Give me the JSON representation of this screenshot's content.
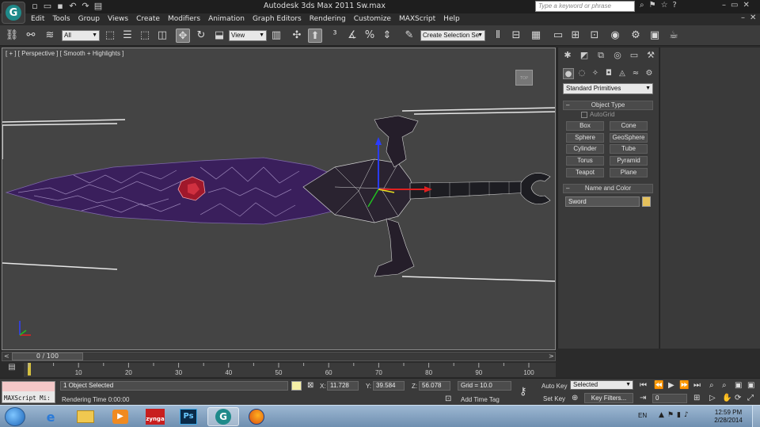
{
  "titlebar": {
    "app_title": "Autodesk 3ds Max  2011      Sw.max",
    "search_placeholder": "Type a keyword or phrase",
    "qat_icons": [
      "new-file-icon",
      "open-file-icon",
      "save-file-icon",
      "undo-icon",
      "redo-icon",
      "project-folder-icon"
    ]
  },
  "menu": {
    "items": [
      "Edit",
      "Tools",
      "Group",
      "Views",
      "Create",
      "Modifiers",
      "Animation",
      "Graph Editors",
      "Rendering",
      "Customize",
      "MAXScript",
      "Help"
    ]
  },
  "toolbar": {
    "filter_select": "All",
    "ref_coord_select": "View",
    "selection_set": "Create Selection Se"
  },
  "viewport": {
    "label": "[ + ] [ Perspective ] [ Smooth + Highlights ]",
    "viewcube_label": "TOP"
  },
  "command_panel": {
    "category_dropdown": "Standard Primitives",
    "object_type_header": "Object Type",
    "autogrid_label": "AutoGrid",
    "primitives": [
      "Box",
      "Cone",
      "Sphere",
      "GeoSphere",
      "Cylinder",
      "Tube",
      "Torus",
      "Pyramid",
      "Teapot",
      "Plane"
    ],
    "name_color_header": "Name and Color",
    "object_name": "Sword",
    "object_color": "#e5c15b"
  },
  "timeline": {
    "frame_counter": "0 / 100",
    "ticks": [
      "10",
      "20",
      "30",
      "40",
      "50",
      "60",
      "70",
      "80",
      "90",
      "100"
    ]
  },
  "status": {
    "maxscript_label": "MAXScript Mi:",
    "selection_status": "1 Object Selected",
    "rendering_time": "Rendering Time  0:00:00",
    "x_label": "X:",
    "x_value": "11.728",
    "y_label": "Y:",
    "y_value": "39.584",
    "z_label": "Z:",
    "z_value": "56.078",
    "grid": "Grid = 10.0",
    "add_time_tag": "Add Time Tag",
    "auto_key": "Auto Key",
    "set_key": "Set Key",
    "key_mode_select": "Selected",
    "key_filters": "Key Filters...",
    "current_frame": "0"
  },
  "taskbar": {
    "apps": [
      "internet-explorer",
      "windows-explorer",
      "media-player",
      "zynga",
      "photoshop",
      "3dsmax",
      "firefox"
    ],
    "zynga_label": "zynga",
    "photoshop_label": "Ps",
    "language": "EN",
    "time": "12:59 PM",
    "date": "2/28/2014"
  }
}
